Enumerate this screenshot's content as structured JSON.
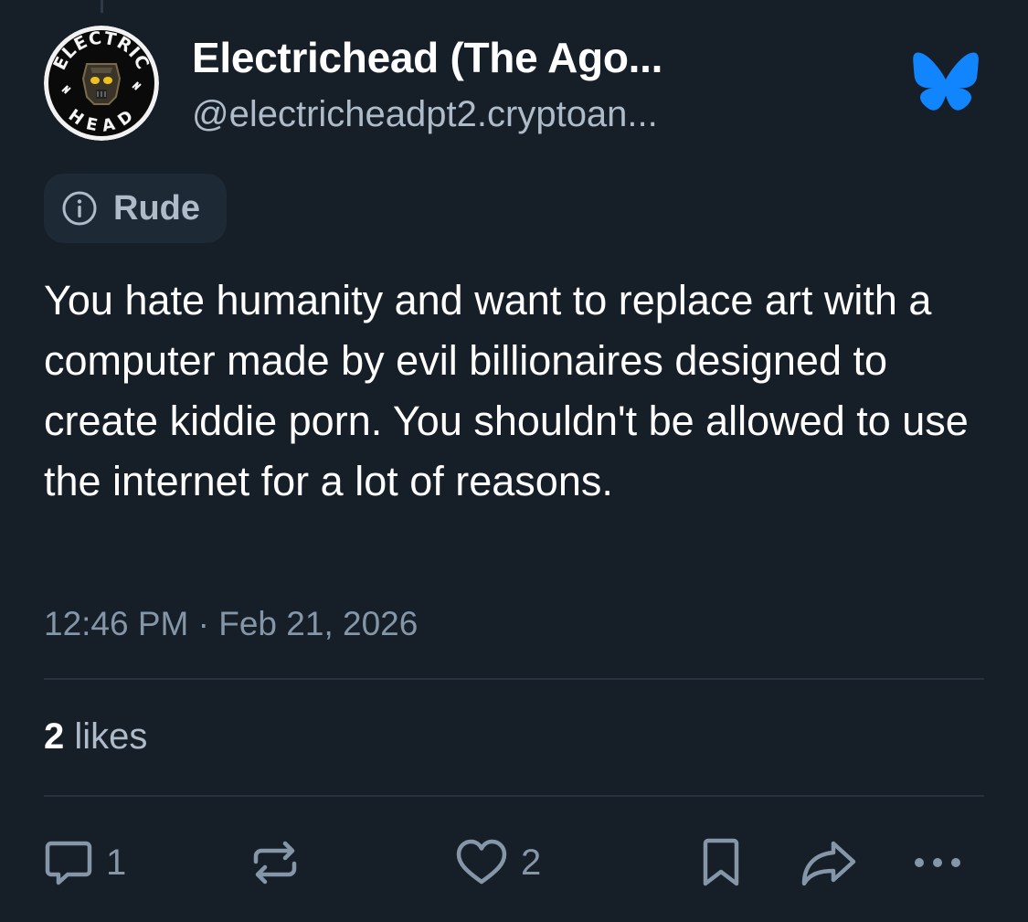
{
  "colors": {
    "background": "#161e27",
    "primary_text": "#ffffff",
    "secondary_text": "#aebbc9",
    "muted_text": "#8596a8",
    "brand_blue": "#1185fe",
    "chip_background": "#1e2936",
    "divider": "#263240"
  },
  "author": {
    "display_name": "Electrichead (The Ago...",
    "handle": "@electricheadpt2.cryptoan...",
    "avatar_text_top": "ELECTRIC",
    "avatar_text_bottom": "HEAD"
  },
  "icons": {
    "brand": "bluesky-butterfly-icon",
    "label": "info-icon",
    "reply": "reply-bubble-icon",
    "repost": "repost-icon",
    "like": "heart-icon",
    "bookmark": "bookmark-icon",
    "share": "share-arrow-icon",
    "more": "more-dots-icon"
  },
  "label": {
    "text": "Rude"
  },
  "post": {
    "text": "You hate humanity and want to replace art with a computer made by evil billionaires designed to create kiddie porn. You shouldn't be allowed to use the internet for a lot of reasons.",
    "timestamp": "12:46 PM · Feb 21, 2026"
  },
  "stats": {
    "likes_count": "2",
    "likes_label": "likes"
  },
  "actions": {
    "reply_count": "1",
    "like_count": "2"
  }
}
